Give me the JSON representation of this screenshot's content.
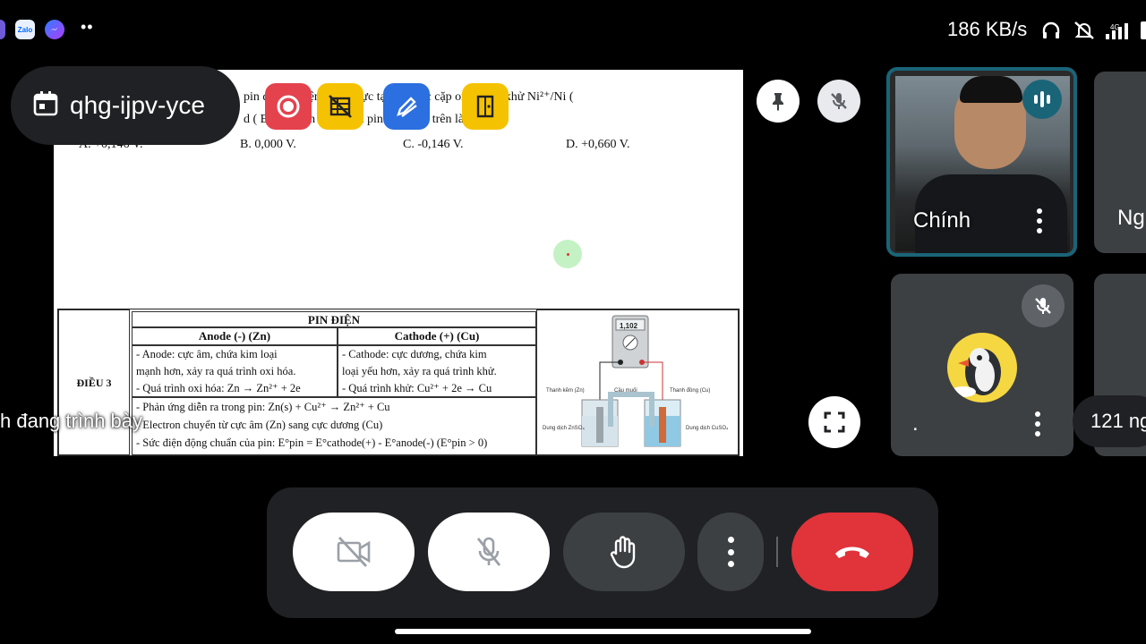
{
  "status_bar": {
    "app_icons": [
      "messenger-like-icon",
      "zalo-icon",
      "messenger-icon"
    ],
    "zalo_label": "Zalo",
    "more": "••",
    "network_speed": "186 KB/s"
  },
  "meeting": {
    "code": "qhg-ijpv-yce"
  },
  "slide": {
    "question_line1": "pin điện hóa         ện          ồm hai       ực tạo bởi các cặp oxi hóa – khử Ni²⁺/Ni (",
    "question_line2": "d ( E                =         V ).      ện động          của pin điện hoá trên là:",
    "options": {
      "a": "A. +0,146 V.",
      "b": "B. 0,000 V.",
      "c": "C. -0,146 V.",
      "d": "D. +0,660 V."
    },
    "table": {
      "row_label": "ĐIỀU 3",
      "header": "PIN ĐIỆN",
      "col_anode": "Anode (-) (Zn)",
      "col_cathode": "Cathode (+) (Cu)",
      "anode_text_1": "- Anode: cực âm, chứa kim loại",
      "anode_text_2": "mạnh hơn, xảy ra quá trình oxi hóa.",
      "anode_text_3": "- Quá trình oxi hóa: Zn → Zn²⁺ + 2e",
      "cathode_text_1": "- Cathode: cực dương, chứa kim",
      "cathode_text_2": "loại yếu hơn, xảy ra quá trình khử.",
      "cathode_text_3": "- Quá trình khử: Cu²⁺ + 2e → Cu",
      "bottom_1": "- Phản ứng diễn ra trong pin: Zn(s) + Cu²⁺ → Zn²⁺ + Cu",
      "bottom_2": "- Electron chuyển từ cực âm (Zn) sang cực dương (Cu)",
      "bottom_3": "- Sức điện động chuẩn của pin: E°pin = E°cathode(+) - E°anode(-) (E°pin > 0)",
      "meter_value": "1,102",
      "lbl_zn": "Thanh kẽm (Zn)",
      "lbl_bridge": "Cầu muối",
      "lbl_cu": "Thanh đồng (Cu)",
      "lbl_znso4": "Dung dịch ZnSO₄",
      "lbl_cuso4": "Dung dịch CuSO₄"
    }
  },
  "caption": {
    "text": "h đang trình bày"
  },
  "participants": [
    {
      "name": "Chính"
    },
    {
      "name": "Ng"
    },
    {
      "name": "."
    },
    {
      "name": "121 ng"
    }
  ],
  "colors": {
    "end_call": "#e0333a",
    "active_speaker_border": "#1a6478",
    "tile_bg": "#3c4043",
    "panel_bg": "#202124"
  }
}
